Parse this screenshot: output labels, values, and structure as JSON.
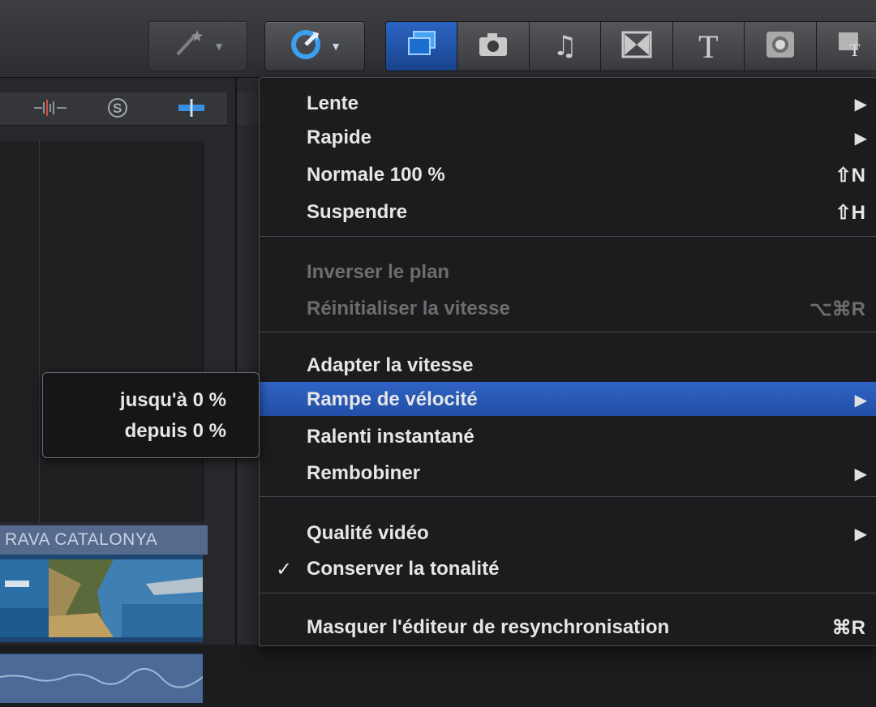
{
  "toolbar": {
    "icons": [
      "magic-wand-icon",
      "retime-icon",
      "clip-browser-icon",
      "camera-icon",
      "music-note-icon",
      "transition-icon",
      "title-icon",
      "generator-icon",
      "theme-icon"
    ],
    "active_color": "#2b63c2"
  },
  "left_panel": {
    "clip_title": "RAVA CATALONYA"
  },
  "menu": {
    "items": [
      {
        "label": "Lente",
        "shortcut": "",
        "submenu": true,
        "enabled": true
      },
      {
        "label": "Rapide",
        "shortcut": "",
        "submenu": true,
        "enabled": true
      },
      {
        "label": "Normale 100 %",
        "shortcut": "⇧N",
        "submenu": false,
        "enabled": true
      },
      {
        "label": "Suspendre",
        "shortcut": "⇧H",
        "submenu": false,
        "enabled": true
      },
      {
        "label": "Inverser le plan",
        "shortcut": "",
        "submenu": false,
        "enabled": false
      },
      {
        "label": "Réinitialiser la vitesse",
        "shortcut": "⌥⌘R",
        "submenu": false,
        "enabled": false
      },
      {
        "label": "Adapter la vitesse",
        "shortcut": "",
        "submenu": false,
        "enabled": true
      },
      {
        "label": "Rampe de vélocité",
        "shortcut": "",
        "submenu": true,
        "enabled": true,
        "highlighted": true
      },
      {
        "label": "Ralenti instantané",
        "shortcut": "",
        "submenu": false,
        "enabled": true
      },
      {
        "label": "Rembobiner",
        "shortcut": "",
        "submenu": true,
        "enabled": true
      },
      {
        "label": "Qualité vidéo",
        "shortcut": "",
        "submenu": true,
        "enabled": true
      },
      {
        "label": "Conserver la tonalité",
        "shortcut": "",
        "submenu": false,
        "enabled": true,
        "checked": true
      },
      {
        "label": "Masquer l'éditeur de resynchronisation",
        "shortcut": "⌘R",
        "submenu": false,
        "enabled": true
      }
    ],
    "check_glyph": "✓",
    "arrow_glyph": "▶",
    "highlight_color": "#2f63c4"
  },
  "tooltip": {
    "line1": "jusqu'à 0 %",
    "line2": "depuis 0 %"
  }
}
